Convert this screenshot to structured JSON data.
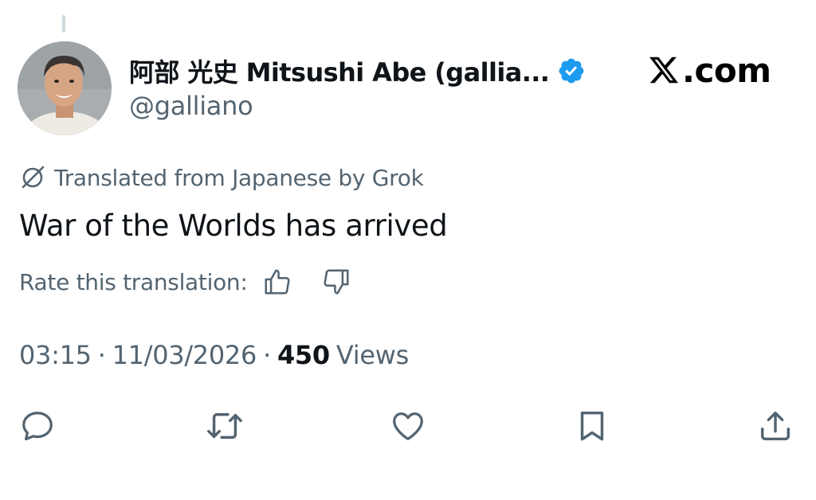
{
  "tweet": {
    "author": {
      "display_name": "阿部 光史 Mitsushi Abe (gallia...",
      "handle": "@galliano",
      "verified": true
    },
    "translation_notice": "Translated from Japanese by Grok",
    "text": "War of the Worlds has arrived",
    "rate_label": "Rate this translation:",
    "timestamp_time": "03:15",
    "timestamp_date": "11/03/2026",
    "separator": "·",
    "views_count": "450",
    "views_label": "Views"
  },
  "watermark": {
    "text": ".com"
  },
  "colors": {
    "primary_text": "#0f1419",
    "secondary_text": "#536471",
    "verified_blue": "#1d9bf0",
    "icon_color": "#536471"
  },
  "icons": {
    "translate": "grok-slash-icon",
    "thumbs_up": "thumbs-up-icon",
    "thumbs_down": "thumbs-down-icon",
    "reply": "reply-icon",
    "repost": "repost-icon",
    "like": "heart-icon",
    "bookmark": "bookmark-icon",
    "share": "share-icon"
  }
}
